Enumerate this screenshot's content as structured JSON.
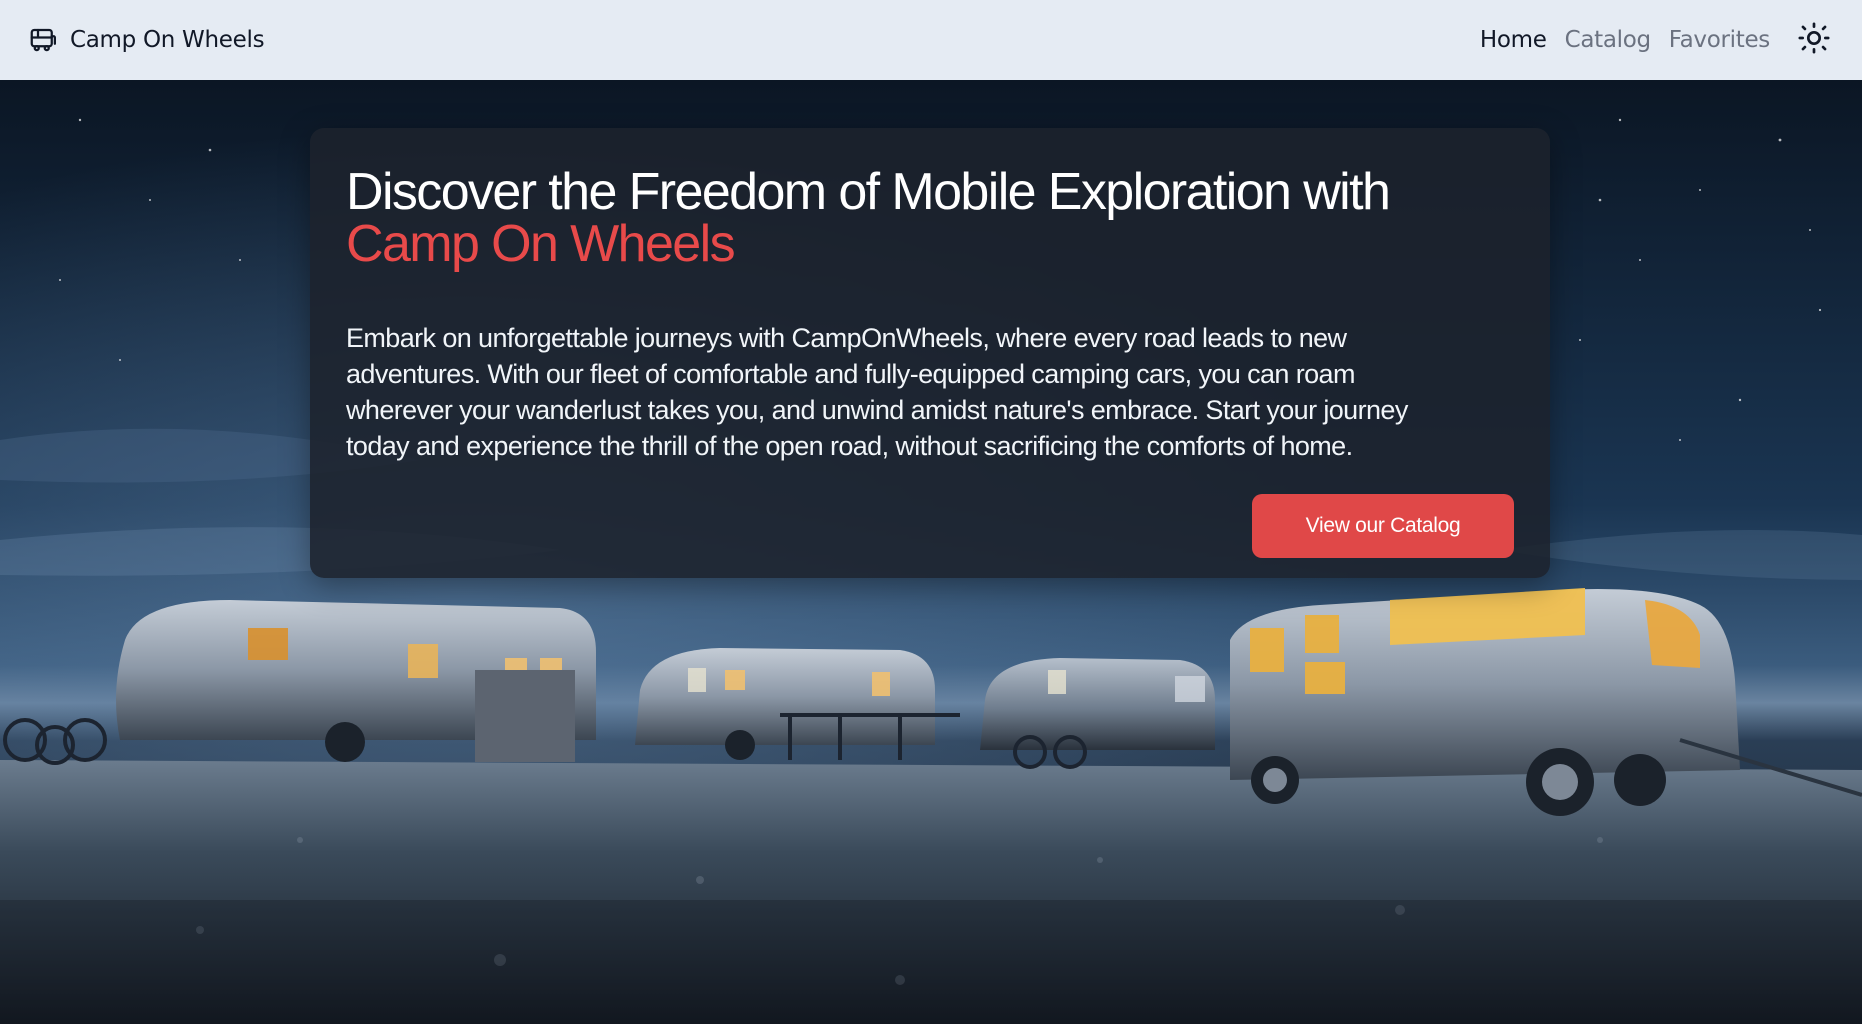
{
  "navbar": {
    "brand_icon": "bus-icon",
    "brand_name": "Camp On Wheels",
    "links": [
      {
        "label": "Home",
        "active": true
      },
      {
        "label": "Catalog",
        "active": false
      },
      {
        "label": "Favorites",
        "active": false
      }
    ],
    "theme_toggle_icon": "sun-icon"
  },
  "hero": {
    "title_prefix": "Discover the Freedom of Mobile Exploration with",
    "title_accent": "Camp On Wheels",
    "description": "Embark on unforgettable journeys with CampOnWheels, where every road leads to new adventures. With our fleet of comfortable and fully-equipped camping cars, you can roam wherever your wanderlust takes you, and unwind amidst nature's embrace. Start your journey today and experience the thrill of the open road, without sacrificing the comforts of home.",
    "cta_label": "View our Catalog",
    "background_image": "night-sky-campervans-photo"
  },
  "colors": {
    "accent": "#e84a4a",
    "navbar_bg": "#e5ebf3",
    "card_bg": "#1c222c"
  }
}
